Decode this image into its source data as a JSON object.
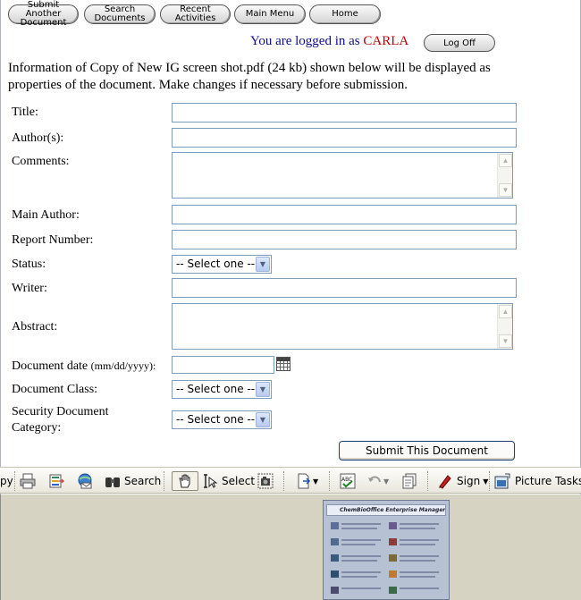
{
  "nav": {
    "buttons": [
      {
        "line1": "Submit Another",
        "line2": "Document"
      },
      {
        "line1": "Search",
        "line2": "Documents"
      },
      {
        "line1": "Recent Activities",
        "line2": ""
      },
      {
        "line1": "Main Menu",
        "line2": ""
      },
      {
        "line1": "Home",
        "line2": ""
      }
    ]
  },
  "session": {
    "logged_in_text": "You are logged in as",
    "username": "CARLA",
    "logoff_label": "Log Off"
  },
  "intro_text": "Information of Copy of New IG screen shot.pdf (24 kb) shown below will be displayed as properties of the document. Make changes if necessary before submission.",
  "form": {
    "title_label": "Title:",
    "title_value": "",
    "authors_label": "Author(s):",
    "authors_value": "",
    "comments_label": "Comments:",
    "comments_value": "",
    "main_author_label": "Main Author:",
    "main_author_value": "",
    "report_number_label": "Report Number:",
    "report_number_value": "",
    "status_label": "Status:",
    "status_selected": "-- Select one --",
    "writer_label": "Writer:",
    "writer_value": "",
    "abstract_label": "Abstract:",
    "abstract_value": "",
    "document_date_label": "Document date",
    "document_date_format": "(mm/dd/yyyy):",
    "document_date_value": "",
    "document_class_label": "Document Class:",
    "document_class_selected": "-- Select one --",
    "security_label_line1": "Security Document",
    "security_label_line2": "Category:",
    "security_selected": "-- Select one --",
    "submit_label": "Submit This Document"
  },
  "acrobat_toolbar": {
    "copy_partial": "py",
    "search_label": "Search",
    "select_label": "Select",
    "sign_label": "Sign",
    "picture_tasks_label": "Picture Tasks",
    "icons": [
      "print-icon",
      "organizer-icon",
      "email-icon",
      "binoculars-icon",
      "hand-icon",
      "select-text-icon",
      "snapshot-icon",
      "page-export-icon",
      "spellcheck-icon",
      "undo-icon",
      "pages-icon",
      "pen-icon",
      "picture-tasks-icon"
    ]
  },
  "preview": {
    "thumbnail_header": "ChemBioOffice Enterprise Manager"
  }
}
